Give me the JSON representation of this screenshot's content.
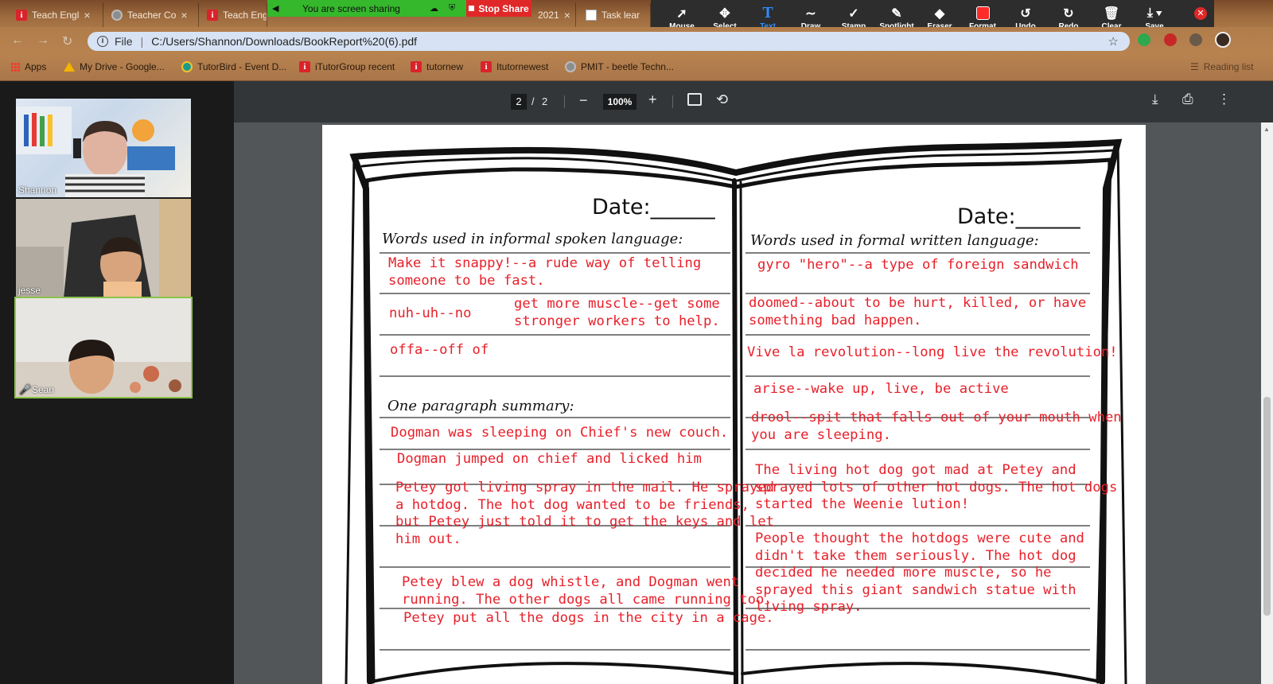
{
  "browser": {
    "tabs": [
      {
        "title": "Teach Engl",
        "icon": "itutor-icon"
      },
      {
        "title": "Teacher Co",
        "icon": "globe-icon"
      },
      {
        "title": "Teach Eng",
        "icon": "itutor-icon"
      },
      {
        "title": "2021",
        "icon": "globe-icon"
      },
      {
        "title": "Task lear",
        "icon": "task-icon"
      }
    ],
    "url_scheme_label": "File",
    "url": "C:/Users/Shannon/Downloads/BookReport%20(6).pdf",
    "bookmarks": [
      {
        "label": "Apps",
        "icon": "apps-grid-icon"
      },
      {
        "label": "My Drive - Google...",
        "icon": "google-drive-icon"
      },
      {
        "label": "TutorBird - Event D...",
        "icon": "tutorbird-icon"
      },
      {
        "label": "iTutorGroup recent",
        "icon": "itutor-icon"
      },
      {
        "label": "tutornew",
        "icon": "itutor-icon"
      },
      {
        "label": "Itutornewest",
        "icon": "itutor-icon"
      },
      {
        "label": "PMIT - beetle Techn...",
        "icon": "globe-icon"
      }
    ],
    "reading_list": "Reading list"
  },
  "zoom_share": {
    "sharing_text": "You are screen sharing",
    "stop_share": "Stop Share",
    "tools": [
      {
        "label": "Mouse",
        "icon": "mouse-pointer-icon"
      },
      {
        "label": "Select",
        "icon": "move-icon"
      },
      {
        "label": "Text",
        "icon": "text-icon"
      },
      {
        "label": "Draw",
        "icon": "draw-icon"
      },
      {
        "label": "Stamp",
        "icon": "stamp-icon"
      },
      {
        "label": "Spotlight",
        "icon": "spotlight-icon"
      },
      {
        "label": "Eraser",
        "icon": "eraser-icon"
      },
      {
        "label": "Format",
        "icon": "format-color-icon"
      },
      {
        "label": "Undo",
        "icon": "undo-icon"
      },
      {
        "label": "Redo",
        "icon": "redo-icon"
      },
      {
        "label": "Clear",
        "icon": "trash-icon"
      },
      {
        "label": "Save",
        "icon": "save-icon"
      }
    ],
    "selected_tool": "Text",
    "format_color": "#ff2a2a"
  },
  "participants": [
    {
      "name": "Shannon"
    },
    {
      "name": "jesse"
    },
    {
      "name": "Sean"
    }
  ],
  "pdf_toolbar": {
    "current_page": "2",
    "separator": "/",
    "total_pages": "2",
    "zoom": "100%"
  },
  "worksheet": {
    "date_label_left": "Date:______",
    "date_label_right": "Date:______",
    "informal_heading": "Words used in informal spoken language:",
    "formal_heading": "Words used in formal written language:",
    "summary_heading": "One paragraph summary:",
    "left_entries": [
      "Make it snappy!--a rude way of telling\nsomeone to be fast.",
      "nuh-uh--no",
      "get more muscle--get some\nstronger workers to help.",
      "offa--off of"
    ],
    "right_entries": [
      "gyro \"hero\"--a type of foreign sandwich",
      "doomed--about to be hurt, killed, or have\nsomething bad happen.",
      "Vive la revolution--long live the revolution!",
      "arise--wake up, live, be active",
      "drool--spit that falls out of your mouth when\nyou are sleeping."
    ],
    "summary_left": [
      "Dogman was sleeping on Chief's new couch.",
      "Dogman jumped on chief and licked him",
      "Petey got living spray in the mail. He sprayed\na hotdog. The hot dog wanted to be friends,\nbut Petey just told it to get the keys and let\nhim out.",
      "Petey blew a dog whistle, and Dogman went\nrunning. The other dogs all came running too.",
      "Petey put all the dogs in the city in a cage."
    ],
    "summary_right": [
      "The living hot dog got mad at Petey and\nsprayed lots of other hot dogs.  The hot dogs\nstarted the Weenie lution!",
      "People thought the hotdogs were cute and\ndidn't take them seriously.  The hot dog\ndecided he needed more muscle, so he\nsprayed  this giant sandwich statue with\nliving spray."
    ],
    "annotation_color": "#e8202a"
  }
}
